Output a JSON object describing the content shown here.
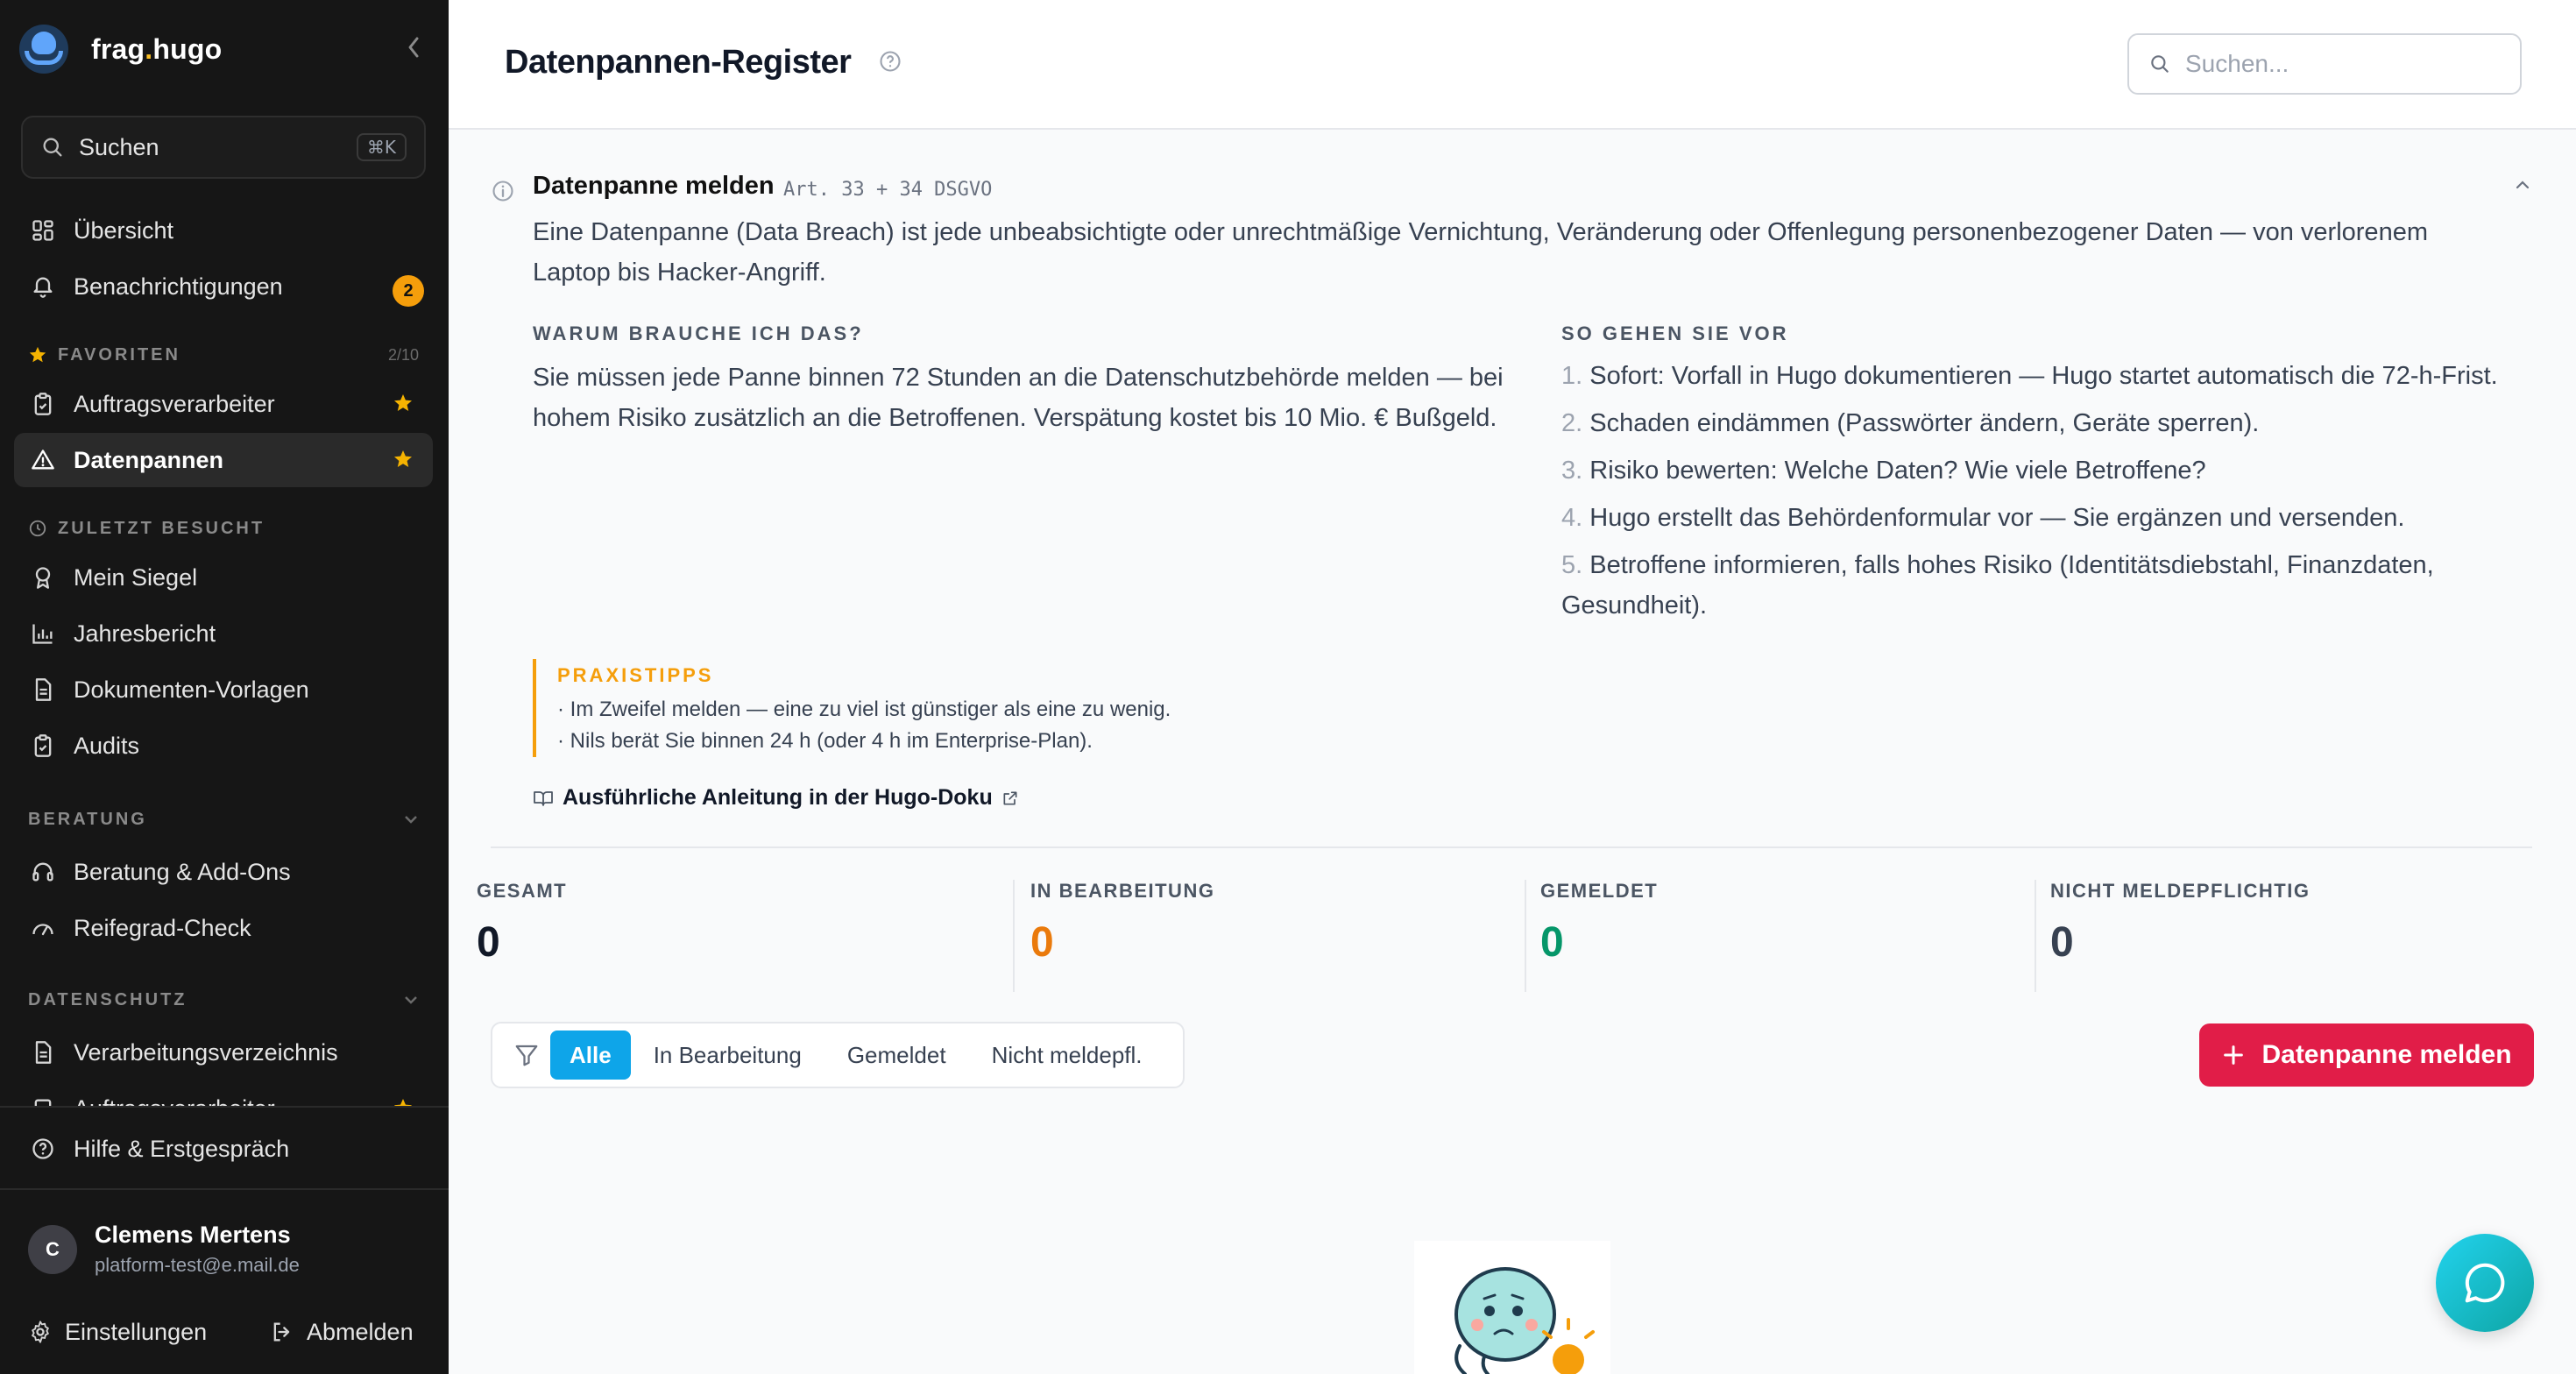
{
  "brand": {
    "name_main": "frag",
    "name_dot": ".",
    "name_end": "hugo"
  },
  "sidebar": {
    "search_label": "Suchen",
    "search_shortcut": "⌘K",
    "overview": "Übersicht",
    "notifications": "Benachrichtigungen",
    "notifications_badge": "2",
    "favorites_title": "FAVORITEN",
    "favorites_count": "2/10",
    "favorites": [
      {
        "label": "Auftragsverarbeiter"
      },
      {
        "label": "Datenpannen"
      }
    ],
    "recent_title": "ZULETZT BESUCHT",
    "recent": [
      {
        "label": "Mein Siegel"
      },
      {
        "label": "Jahresbericht"
      },
      {
        "label": "Dokumenten-Vorlagen"
      },
      {
        "label": "Audits"
      }
    ],
    "consult_title": "BERATUNG",
    "consult": [
      {
        "label": "Beratung & Add-Ons"
      },
      {
        "label": "Reifegrad-Check"
      }
    ],
    "privacy_title": "DATENSCHUTZ",
    "privacy": [
      {
        "label": "Verarbeitungsverzeichnis"
      },
      {
        "label": "Auftragsverarbeiter"
      }
    ],
    "help": "Hilfe & Erstgespräch",
    "user_name": "Clemens Mertens",
    "user_email": "platform-test@e.mail.de",
    "user_initial": "C",
    "settings": "Einstellungen",
    "logout": "Abmelden"
  },
  "header": {
    "title": "Datenpannen-Register",
    "search_placeholder": "Suchen..."
  },
  "info": {
    "title": "Datenpanne melden",
    "tag": "Art. 33 + 34 DSGVO",
    "description": "Eine Datenpanne (Data Breach) ist jede unbeabsichtigte oder unrechtmäßige Vernichtung, Veränderung oder Offenlegung personenbezogener Daten — von verlorenem Laptop bis Hacker-Angriff.",
    "why_title": "WARUM BRAUCHE ICH DAS?",
    "why_text": "Sie müssen jede Panne binnen 72 Stunden an die Datenschutzbehörde melden — bei hohem Risiko zusätzlich an die Betroffenen. Verspätung kostet bis 10 Mio. € Bußgeld.",
    "how_title": "SO GEHEN SIE VOR",
    "steps": [
      {
        "num": "1.",
        "text": "Sofort: Vorfall in Hugo dokumentieren — Hugo startet automatisch die 72-h-Frist."
      },
      {
        "num": "2.",
        "text": "Schaden eindämmen (Passwörter ändern, Geräte sperren)."
      },
      {
        "num": "3.",
        "text": "Risiko bewerten: Welche Daten? Wie viele Betroffene?"
      },
      {
        "num": "4.",
        "text": "Hugo erstellt das Behördenformular vor — Sie ergänzen und versenden."
      },
      {
        "num": "5.",
        "text": "Betroffene informieren, falls hohes Risiko (Identitätsdiebstahl, Finanzdaten, Gesundheit)."
      }
    ],
    "tips_title": "PRAXISTIPPS",
    "tips": [
      "· Im Zweifel melden — eine zu viel ist günstiger als eine zu wenig.",
      "· Nils berät Sie binnen 24 h (oder 4 h im Enterprise-Plan)."
    ],
    "doc_link": "Ausführliche Anleitung in der Hugo-Doku"
  },
  "stats": [
    {
      "label": "GESAMT",
      "value": "0",
      "color": "#111827"
    },
    {
      "label": "IN BEARBEITUNG",
      "value": "0",
      "color": "#ea7a0c"
    },
    {
      "label": "GEMELDET",
      "value": "0",
      "color": "#059669"
    },
    {
      "label": "NICHT MELDEPFLICHTIG",
      "value": "0",
      "color": "#374151"
    }
  ],
  "filters": {
    "options": [
      "Alle",
      "In Bearbeitung",
      "Gemeldet",
      "Nicht meldepfl."
    ],
    "active": "Alle"
  },
  "cta_label": "Datenpanne melden",
  "colors": {
    "accent": "#0ea5e9",
    "cta": "#e11d48",
    "favorite_star": "#f5b301",
    "badge": "#f59e0b"
  }
}
